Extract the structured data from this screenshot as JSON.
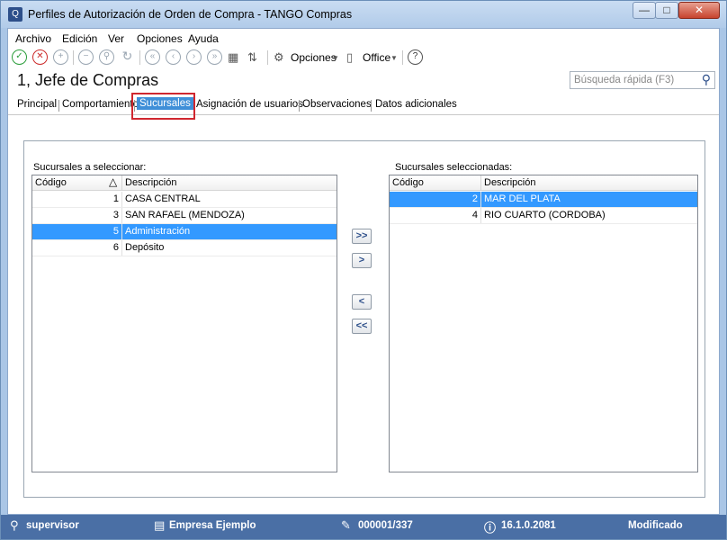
{
  "window": {
    "title": "Perfiles de Autorización de Orden de Compra - TANGO Compras",
    "min": "—",
    "max": "□",
    "close": "✕"
  },
  "menu": [
    "Archivo",
    "Edición",
    "Ver",
    "Opciones",
    "Ayuda"
  ],
  "toolbar": {
    "opciones": "Opciones",
    "office": "Office",
    "help": "?"
  },
  "header": {
    "title": "1, Jefe de Compras",
    "search_placeholder": "Búsqueda rápida (F3)"
  },
  "tabs": [
    "Principal",
    "Comportamiento",
    "Sucursales",
    "Asignación de usuarios",
    "Observaciones",
    "Datos adicionales"
  ],
  "active_tab": "Sucursales",
  "left_list": {
    "label": "Sucursales a seleccionar:",
    "columns": [
      "Código",
      "Descripción"
    ],
    "sort_indicator": "△",
    "rows": [
      {
        "code": "1",
        "desc": "CASA CENTRAL"
      },
      {
        "code": "3",
        "desc": "SAN RAFAEL (MENDOZA)"
      },
      {
        "code": "5",
        "desc": "Administración"
      },
      {
        "code": "6",
        "desc": "Depósito"
      }
    ],
    "selected_row": 2
  },
  "right_list": {
    "label": "Sucursales seleccionadas:",
    "columns": [
      "Código",
      "Descripción"
    ],
    "rows": [
      {
        "code": "2",
        "desc": "MAR DEL PLATA"
      },
      {
        "code": "4",
        "desc": "RIO CUARTO (CORDOBA)"
      }
    ],
    "selected_row": 0
  },
  "move_buttons": {
    "add_all": ">>",
    "add": ">",
    "remove": "<",
    "remove_all": "<<"
  },
  "statusbar": {
    "user": "supervisor",
    "company": "Empresa Ejemplo",
    "code": "000001/337",
    "version": "16.1.0.2081",
    "state": "Modificado"
  },
  "colors": {
    "statusbar": "#4a6fa5",
    "selection": "#3399ff",
    "highlight": "#d0272f"
  }
}
